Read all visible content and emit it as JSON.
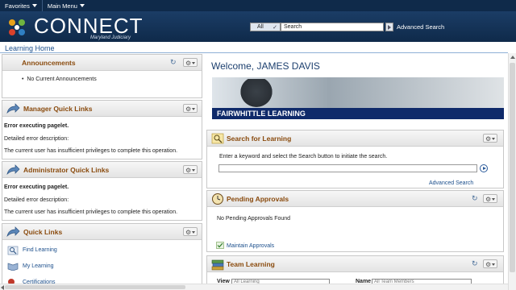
{
  "menubar": {
    "favorites": "Favorites",
    "main_menu": "Main Menu"
  },
  "banner": {
    "logo": "CONNECT",
    "subtitle": "Maryland Judiciary",
    "search_scope": "All",
    "search_value": "Search",
    "advanced_search": "Advanced Search"
  },
  "page": {
    "title": "Learning Home"
  },
  "announcements": {
    "title": "Announcements",
    "item": "No Current Announcements"
  },
  "manager": {
    "title": "Manager Quick Links",
    "error": "Error executing pagelet.",
    "desc": "Detailed error description:",
    "msg": "The current user has insufficient privileges to complete this operation."
  },
  "admin": {
    "title": "Administrator Quick Links",
    "error": "Error executing pagelet.",
    "desc": "Detailed error description:",
    "msg": "The current user has insufficient privileges to complete this operation."
  },
  "quick_links": {
    "title": "Quick Links",
    "items": [
      "Find Learning",
      "My Learning",
      "Certifications"
    ]
  },
  "welcome": "Welcome, JAMES DAVIS",
  "learn_banner": "FAIRWHITTLE LEARNING",
  "search_learning": {
    "title": "Search for Learning",
    "instructions": "Enter a keyword and select the Search button to initiate the search.",
    "advanced": "Advanced Search"
  },
  "pending": {
    "title": "Pending Approvals",
    "empty": "No Pending Approvals Found",
    "maintain": "Maintain Approvals"
  },
  "team": {
    "title": "Team Learning",
    "view_label": "View",
    "view_value": "All Learning",
    "name_label": "Name",
    "name_value": "All Team Members"
  },
  "colors": {
    "brand_navy": "#0f2a4a",
    "header_title": "#8a4b0e",
    "link": "#1c4f8c"
  }
}
